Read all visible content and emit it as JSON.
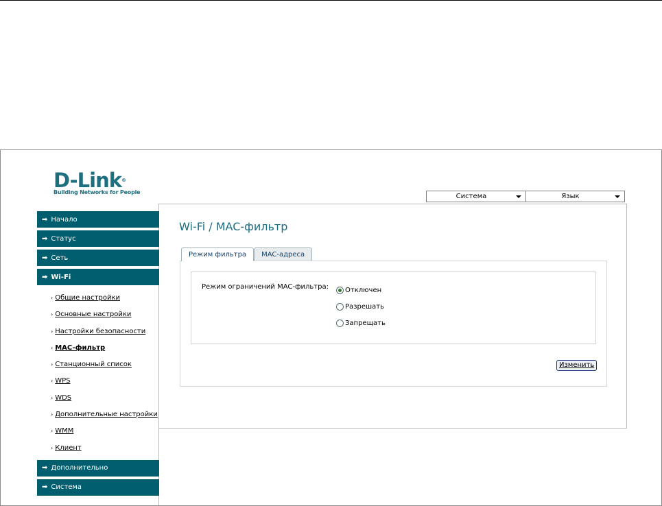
{
  "brand": {
    "logo_text": "D-Link",
    "tagline": "Building Networks for People",
    "colors": {
      "accent": "#005e6f",
      "title": "#1c6d80"
    }
  },
  "topbar": {
    "system_label": "Система",
    "language_label": "Язык"
  },
  "sidebar": {
    "items": [
      {
        "label": "Начало",
        "icon": "arrow-right-icon"
      },
      {
        "label": "Статус",
        "icon": "arrow-right-icon"
      },
      {
        "label": "Сеть",
        "icon": "arrow-right-icon"
      },
      {
        "label": "Wi-Fi",
        "icon": "arrow-right-icon",
        "active": true
      },
      {
        "label": "Дополнительно",
        "icon": "arrow-right-icon"
      },
      {
        "label": "Система",
        "icon": "arrow-right-icon"
      }
    ],
    "wifi_subitems": [
      {
        "label": "Общие настройки"
      },
      {
        "label": "Основные настройки"
      },
      {
        "label": "Настройки безопасности"
      },
      {
        "label": "MAC-фильтр",
        "current": true
      },
      {
        "label": "Станционный список"
      },
      {
        "label": "WPS"
      },
      {
        "label": "WDS"
      },
      {
        "label": "Дополнительные настройки"
      },
      {
        "label": "WMM"
      },
      {
        "label": "Клиент"
      }
    ]
  },
  "main": {
    "title": "Wi-Fi /  MAC-фильтр",
    "tabs": [
      {
        "label": "Режим фильтра",
        "active": true
      },
      {
        "label": "MAC-адреса",
        "active": false
      }
    ],
    "form": {
      "label": "Режим ограничений MAC-фильтра:",
      "options": [
        {
          "label": "Отключен",
          "checked": true
        },
        {
          "label": "Разрешать",
          "checked": false
        },
        {
          "label": "Запрещать",
          "checked": false
        }
      ]
    },
    "change_button": "Изменить"
  }
}
